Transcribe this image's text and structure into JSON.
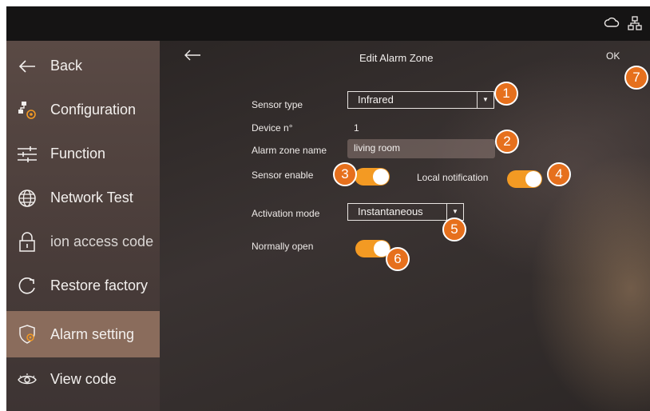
{
  "colors": {
    "accent": "#f39a23",
    "badge": "#e6701d",
    "active_menu": "#8a6c5c"
  },
  "topbar": {
    "icons": [
      "cloud-icon",
      "network-icon"
    ]
  },
  "sidebar": {
    "items": [
      {
        "label": "Back",
        "icon": "back-arrow-icon",
        "active": false
      },
      {
        "label": "Configuration",
        "icon": "configuration-icon",
        "active": false
      },
      {
        "label": "Function",
        "icon": "sliders-icon",
        "active": false
      },
      {
        "label": "Network Test",
        "icon": "globe-icon",
        "active": false
      },
      {
        "label": "ion access code",
        "icon": "lock-icon",
        "active": false
      },
      {
        "label": "Restore factory",
        "icon": "restore-icon",
        "active": false
      },
      {
        "label": "Alarm setting",
        "icon": "alarm-shield-icon",
        "active": true
      },
      {
        "label": "View code",
        "icon": "eye-icon",
        "active": false
      }
    ]
  },
  "header": {
    "title": "Edit Alarm Zone",
    "ok_label": "OK"
  },
  "form": {
    "sensor_type": {
      "label": "Sensor type",
      "value": "Infrared"
    },
    "device_n": {
      "label": "Device n°",
      "value": "1"
    },
    "zone_name": {
      "label": "Alarm zone name",
      "value": "living room"
    },
    "sensor_enable": {
      "label": "Sensor enable",
      "on": true
    },
    "local_notification": {
      "label": "Local notification",
      "on": true
    },
    "activation_mode": {
      "label": "Activation mode",
      "value": "Instantaneous"
    },
    "normally_open": {
      "label": "Normally open",
      "on": true
    }
  },
  "badges": [
    "1",
    "2",
    "3",
    "4",
    "5",
    "6",
    "7"
  ]
}
